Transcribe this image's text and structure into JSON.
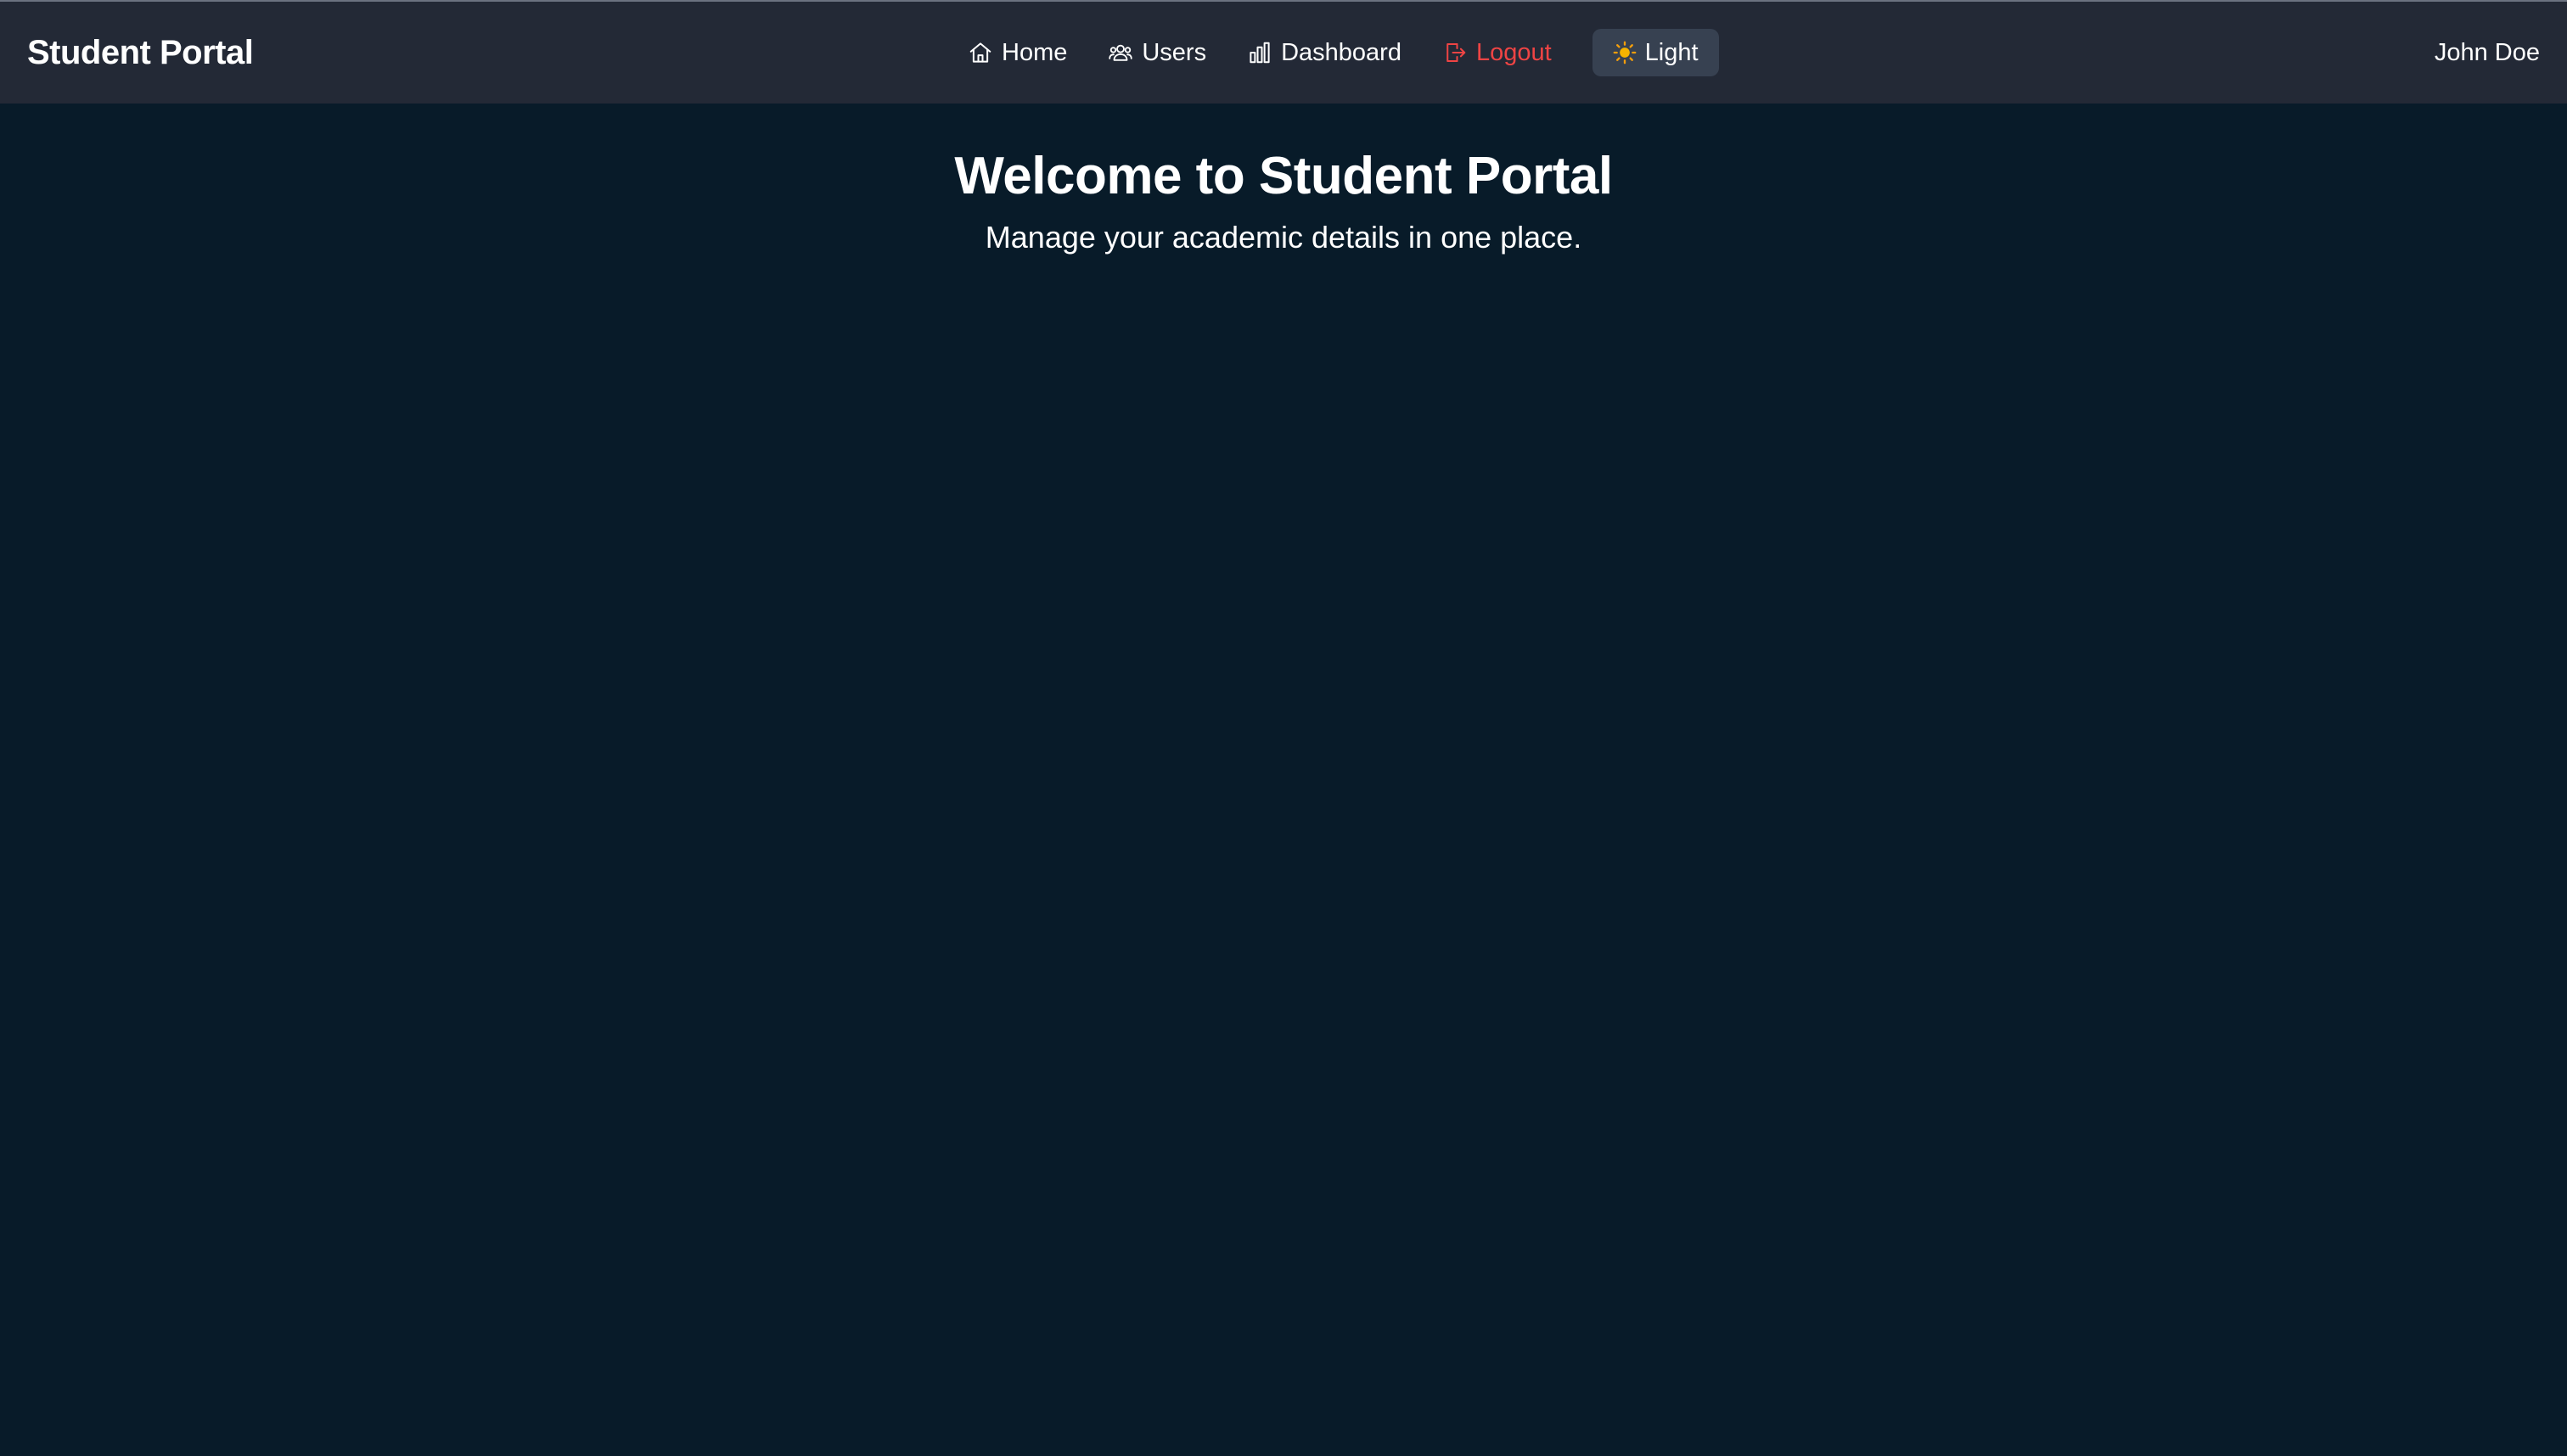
{
  "app": {
    "brand": "Student Portal",
    "user_name": "John Doe"
  },
  "nav": {
    "items": [
      {
        "label": "Home",
        "icon": "home-icon"
      },
      {
        "label": "Users",
        "icon": "users-icon"
      },
      {
        "label": "Dashboard",
        "icon": "bar-chart-icon"
      },
      {
        "label": "Logout",
        "icon": "logout-icon",
        "color": "#ef4444"
      }
    ],
    "theme_toggle": {
      "label": "Light",
      "icon": "sun-icon"
    }
  },
  "hero": {
    "title": "Welcome to Student Portal",
    "subtitle": "Manage your academic details in one place."
  },
  "colors": {
    "background": "#081b29",
    "topbar": "#232936",
    "logout": "#ef4444",
    "toggle_bg": "#374151",
    "sun": "#f5b301"
  }
}
